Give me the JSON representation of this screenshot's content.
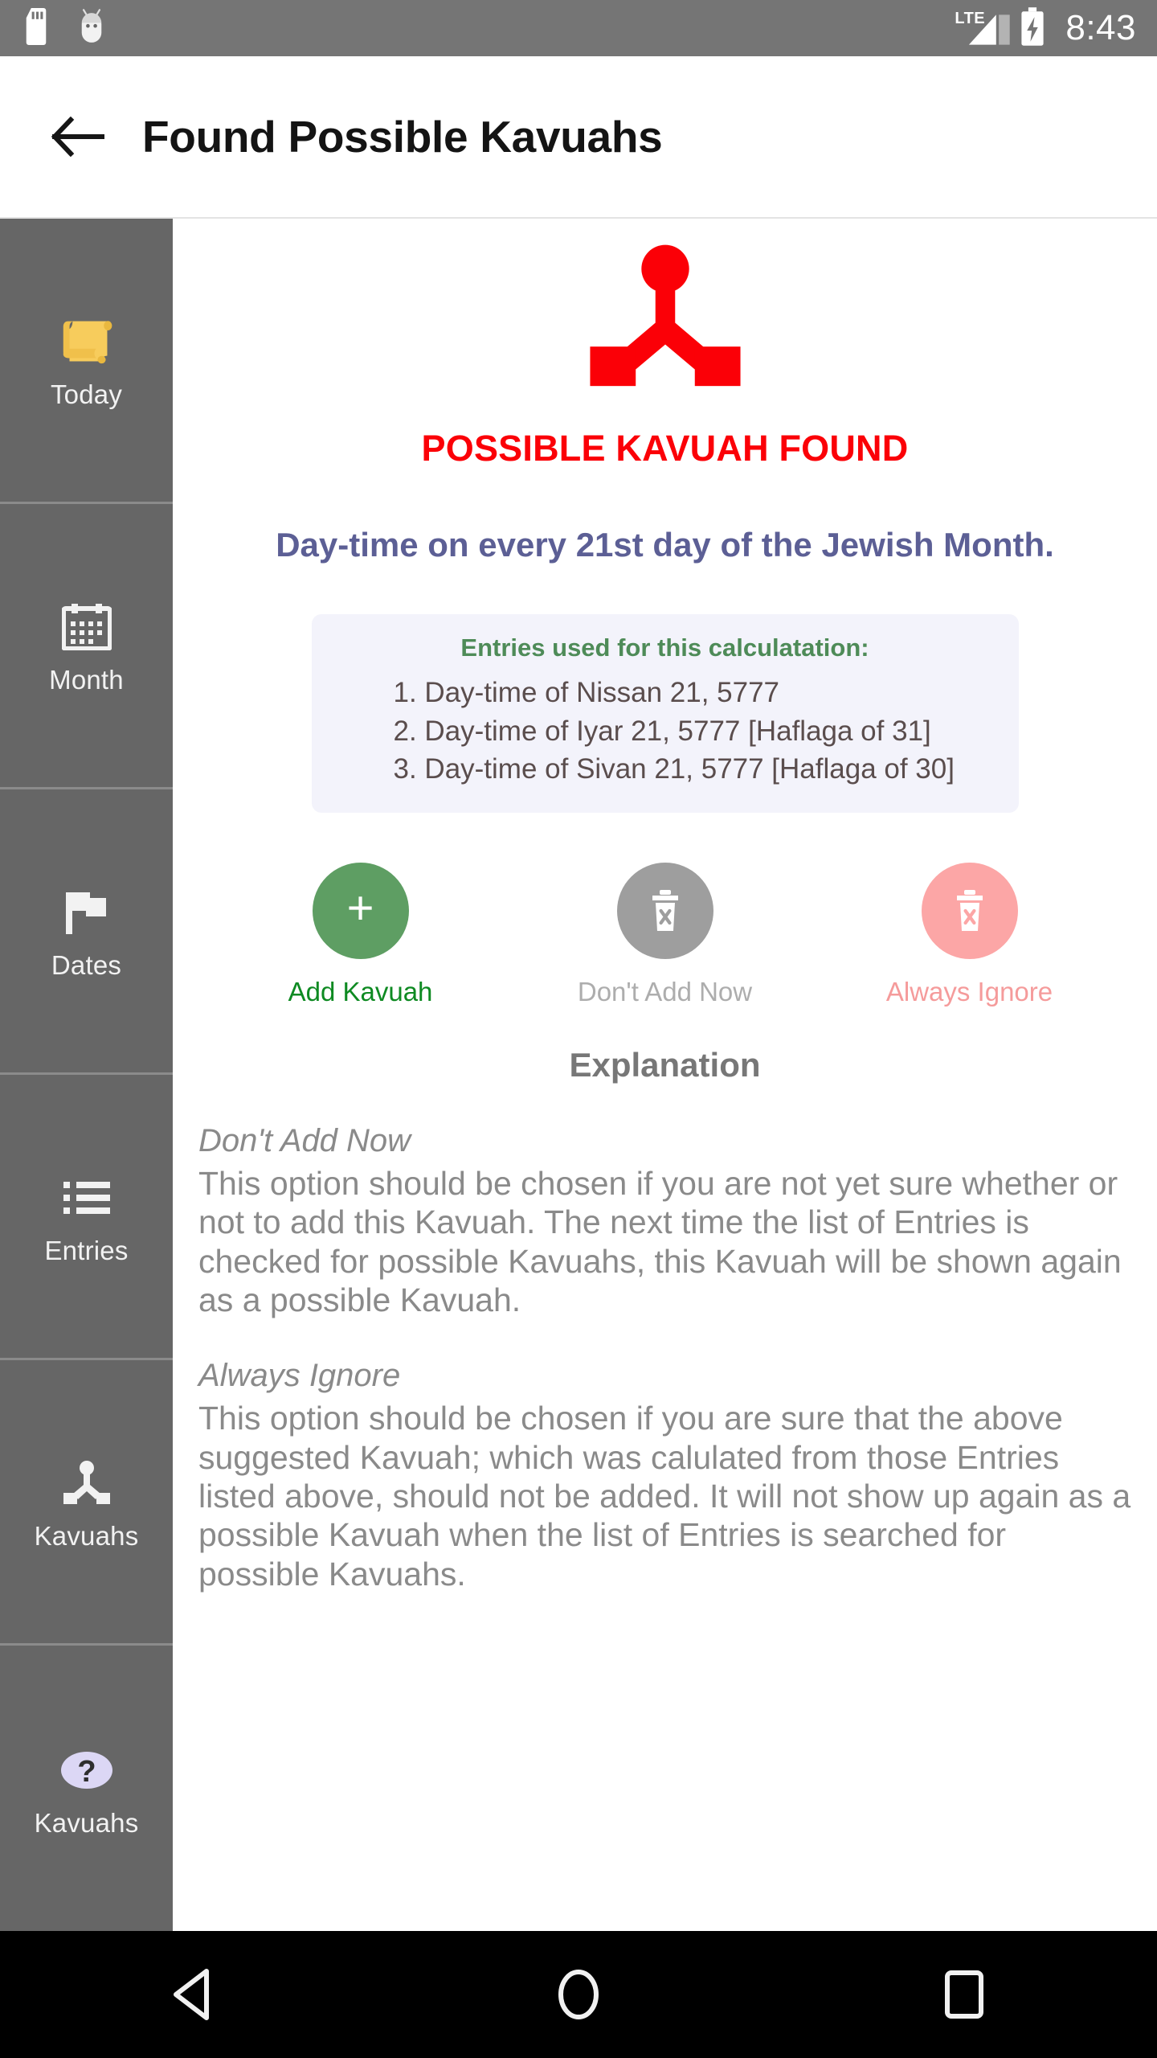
{
  "statusbar": {
    "time": "8:43",
    "network_label": "LTE",
    "icons": [
      "sd-card-icon",
      "android-head-icon",
      "lte-signal-icon",
      "battery-charging-icon"
    ]
  },
  "appbar": {
    "back_icon": "arrow-left-icon",
    "title": "Found Possible Kavuahs"
  },
  "sidebar": {
    "items": [
      {
        "label": "Today",
        "icon": "scroll-icon"
      },
      {
        "label": "Month",
        "icon": "calendar-icon"
      },
      {
        "label": "Dates",
        "icon": "flag-icon"
      },
      {
        "label": "Entries",
        "icon": "list-icon"
      },
      {
        "label": "Kavuahs",
        "icon": "device-hub-icon"
      },
      {
        "label": "Kavuahs",
        "icon": "question-mark-icon"
      }
    ]
  },
  "main": {
    "hero_icon": "device-hub-icon",
    "headline": "POSSIBLE KAVUAH FOUND",
    "subheadline": "Day-time on every 21st day of the Jewish Month.",
    "entries_card": {
      "title": "Entries used for this calculatation:",
      "entries": [
        "1. Day-time of Nissan 21, 5777",
        "2. Day-time of Iyar 21, 5777 [Haflaga of 31]",
        "3. Day-time of Sivan 21, 5777 [Haflaga of 30]"
      ]
    },
    "actions": [
      {
        "label": "Add Kavuah",
        "icon": "plus-icon",
        "color": "#5e9e63"
      },
      {
        "label": "Don't Add Now",
        "icon": "delete-forever-icon",
        "color": "#9e9e9e"
      },
      {
        "label": "Always Ignore",
        "icon": "delete-forever-icon",
        "color": "#fca6a6"
      }
    ],
    "explanation": {
      "title": "Explanation",
      "sections": [
        {
          "heading": "Don't Add Now",
          "body": "This option should be chosen if you are not yet sure whether or not to add this Kavuah. The next time the list of Entries is checked for possible Kavuahs, this Kavuah will be shown again as a possible Kavuah."
        },
        {
          "heading": "Always Ignore",
          "body": "This option should be chosen if you are sure that the above suggested Kavuah; which was calulated from those Entries listed above, should not be added. It will not show up again as a possible Kavuah when the list of Entries is searched for possible Kavuahs."
        }
      ]
    }
  },
  "navbar": {
    "back_icon": "nav-back-triangle-icon",
    "home_icon": "nav-home-circle-icon",
    "recents_icon": "nav-recents-square-icon"
  },
  "colors": {
    "status_bar": "#757575",
    "sidebar": "#666666",
    "headline_red": "#fb0007",
    "subhead_purple": "#5c5f95",
    "card_bg": "#f3f3fb",
    "card_title_green": "#4e8b58",
    "add_green": "#5e9e63",
    "later_gray": "#9e9e9e",
    "ignore_pink": "#fca6a6",
    "nav_bar": "#000000"
  }
}
